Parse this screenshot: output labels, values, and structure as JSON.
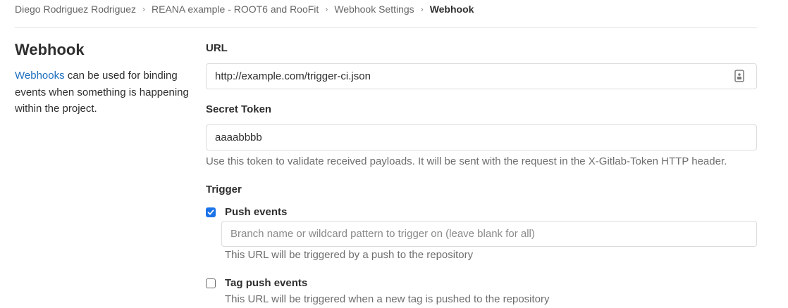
{
  "breadcrumb": {
    "items": [
      "Diego Rodriguez Rodriguez",
      "REANA example - ROOT6 and RooFit",
      "Webhook Settings"
    ],
    "current": "Webhook"
  },
  "section": {
    "title": "Webhook",
    "link_text": "Webhooks",
    "description": "can be used for binding events when something is happening within the project."
  },
  "form": {
    "url": {
      "label": "URL",
      "value": "http://example.com/trigger-ci.json"
    },
    "secret_token": {
      "label": "Secret Token",
      "value": "aaaabbbb",
      "help": "Use this token to validate received payloads. It will be sent with the request in the X-Gitlab-Token HTTP header."
    },
    "trigger": {
      "label": "Trigger",
      "push_events": {
        "label": "Push events",
        "checked": true,
        "branch_placeholder": "Branch name or wildcard pattern to trigger on (leave blank for all)",
        "help": "This URL will be triggered by a push to the repository"
      },
      "tag_push_events": {
        "label": "Tag push events",
        "checked": false,
        "help": "This URL will be triggered when a new tag is pushed to the repository"
      }
    }
  },
  "colors": {
    "link": "#1f6fbf",
    "checkbox_checked": "#1a73e8",
    "muted_text": "#6e6e6e"
  },
  "icons": {
    "url_field_icon": "password-manager-icon",
    "breadcrumb_separator": "chevron-right-icon"
  }
}
